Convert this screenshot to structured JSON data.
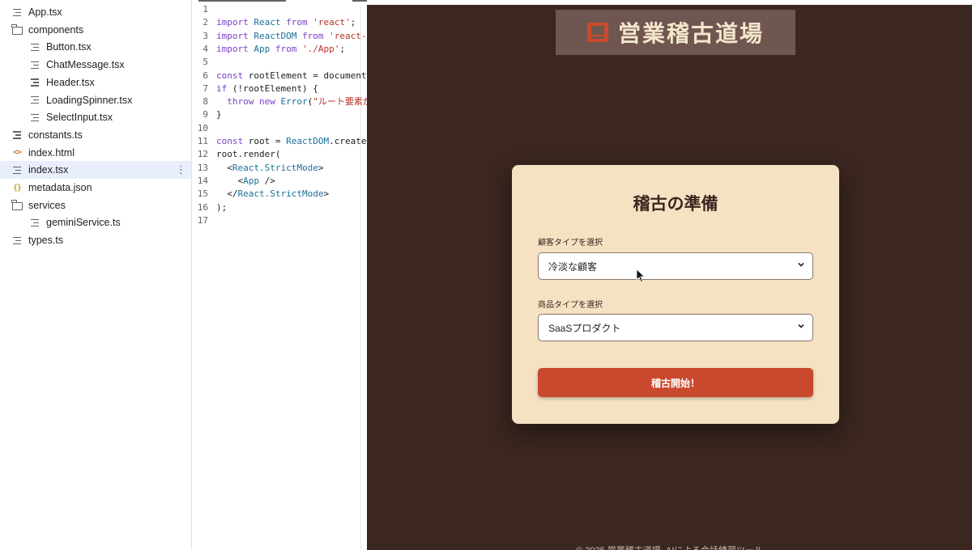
{
  "file_tree": {
    "items": [
      {
        "name": "App.tsx",
        "icon": "file-lines-icon"
      },
      {
        "name": "components",
        "icon": "folder-icon"
      },
      {
        "name": "Button.tsx",
        "icon": "file-lines-icon"
      },
      {
        "name": "ChatMessage.tsx",
        "icon": "file-lines-icon"
      },
      {
        "name": "Header.tsx",
        "icon": "file-lines-icon"
      },
      {
        "name": "LoadingSpinner.tsx",
        "icon": "file-lines-icon"
      },
      {
        "name": "SelectInput.tsx",
        "icon": "file-lines-icon"
      },
      {
        "name": "constants.ts",
        "icon": "file-lines-icon"
      },
      {
        "name": "index.html",
        "icon": "code-icon"
      },
      {
        "name": "index.tsx",
        "icon": "file-lines-icon"
      },
      {
        "name": "metadata.json",
        "icon": "json-icon"
      },
      {
        "name": "services",
        "icon": "folder-icon"
      },
      {
        "name": "geminiService.ts",
        "icon": "file-lines-icon"
      },
      {
        "name": "types.ts",
        "icon": "file-lines-icon"
      }
    ],
    "active": "index.tsx",
    "more_icon": "⋮"
  },
  "editor": {
    "lines": [
      {
        "n": "1",
        "code": ""
      },
      {
        "n": "2",
        "code": "import React from 'react';"
      },
      {
        "n": "3",
        "code": "import ReactDOM from 'react-c"
      },
      {
        "n": "4",
        "code": "import App from './App';"
      },
      {
        "n": "5",
        "code": ""
      },
      {
        "n": "6",
        "code": "const rootElement = document."
      },
      {
        "n": "7",
        "code": "if (!rootElement) {"
      },
      {
        "n": "8",
        "code": "  throw new Error(\"ルート要素が"
      },
      {
        "n": "9",
        "code": "}"
      },
      {
        "n": "10",
        "code": ""
      },
      {
        "n": "11",
        "code": "const root = ReactDOM.createR"
      },
      {
        "n": "12",
        "code": "root.render("
      },
      {
        "n": "13",
        "code": "  <React.StrictMode>"
      },
      {
        "n": "14",
        "code": "    <App />"
      },
      {
        "n": "15",
        "code": "  </React.StrictMode>"
      },
      {
        "n": "16",
        "code": ");"
      },
      {
        "n": "17",
        "code": ""
      }
    ]
  },
  "preview": {
    "header": {
      "title": "営業稽古道場",
      "icon": "dojo-logo-icon"
    },
    "card": {
      "title": "稽古の準備",
      "customer_label": "顧客タイプを選択",
      "customer_value": "冷淡な顧客",
      "product_label": "商品タイプを選択",
      "product_value": "SaaSプロダクト",
      "start_button": "稽古開始！"
    },
    "footer": "© 2025 営業稽古道場. AIによる会話練習ツール"
  },
  "colors": {
    "preview_bg": "#3b2620",
    "header_bg": "#6f5650",
    "card_bg": "#f4e2c3",
    "accent": "#c9492f",
    "active_row": "#e8eefb"
  }
}
